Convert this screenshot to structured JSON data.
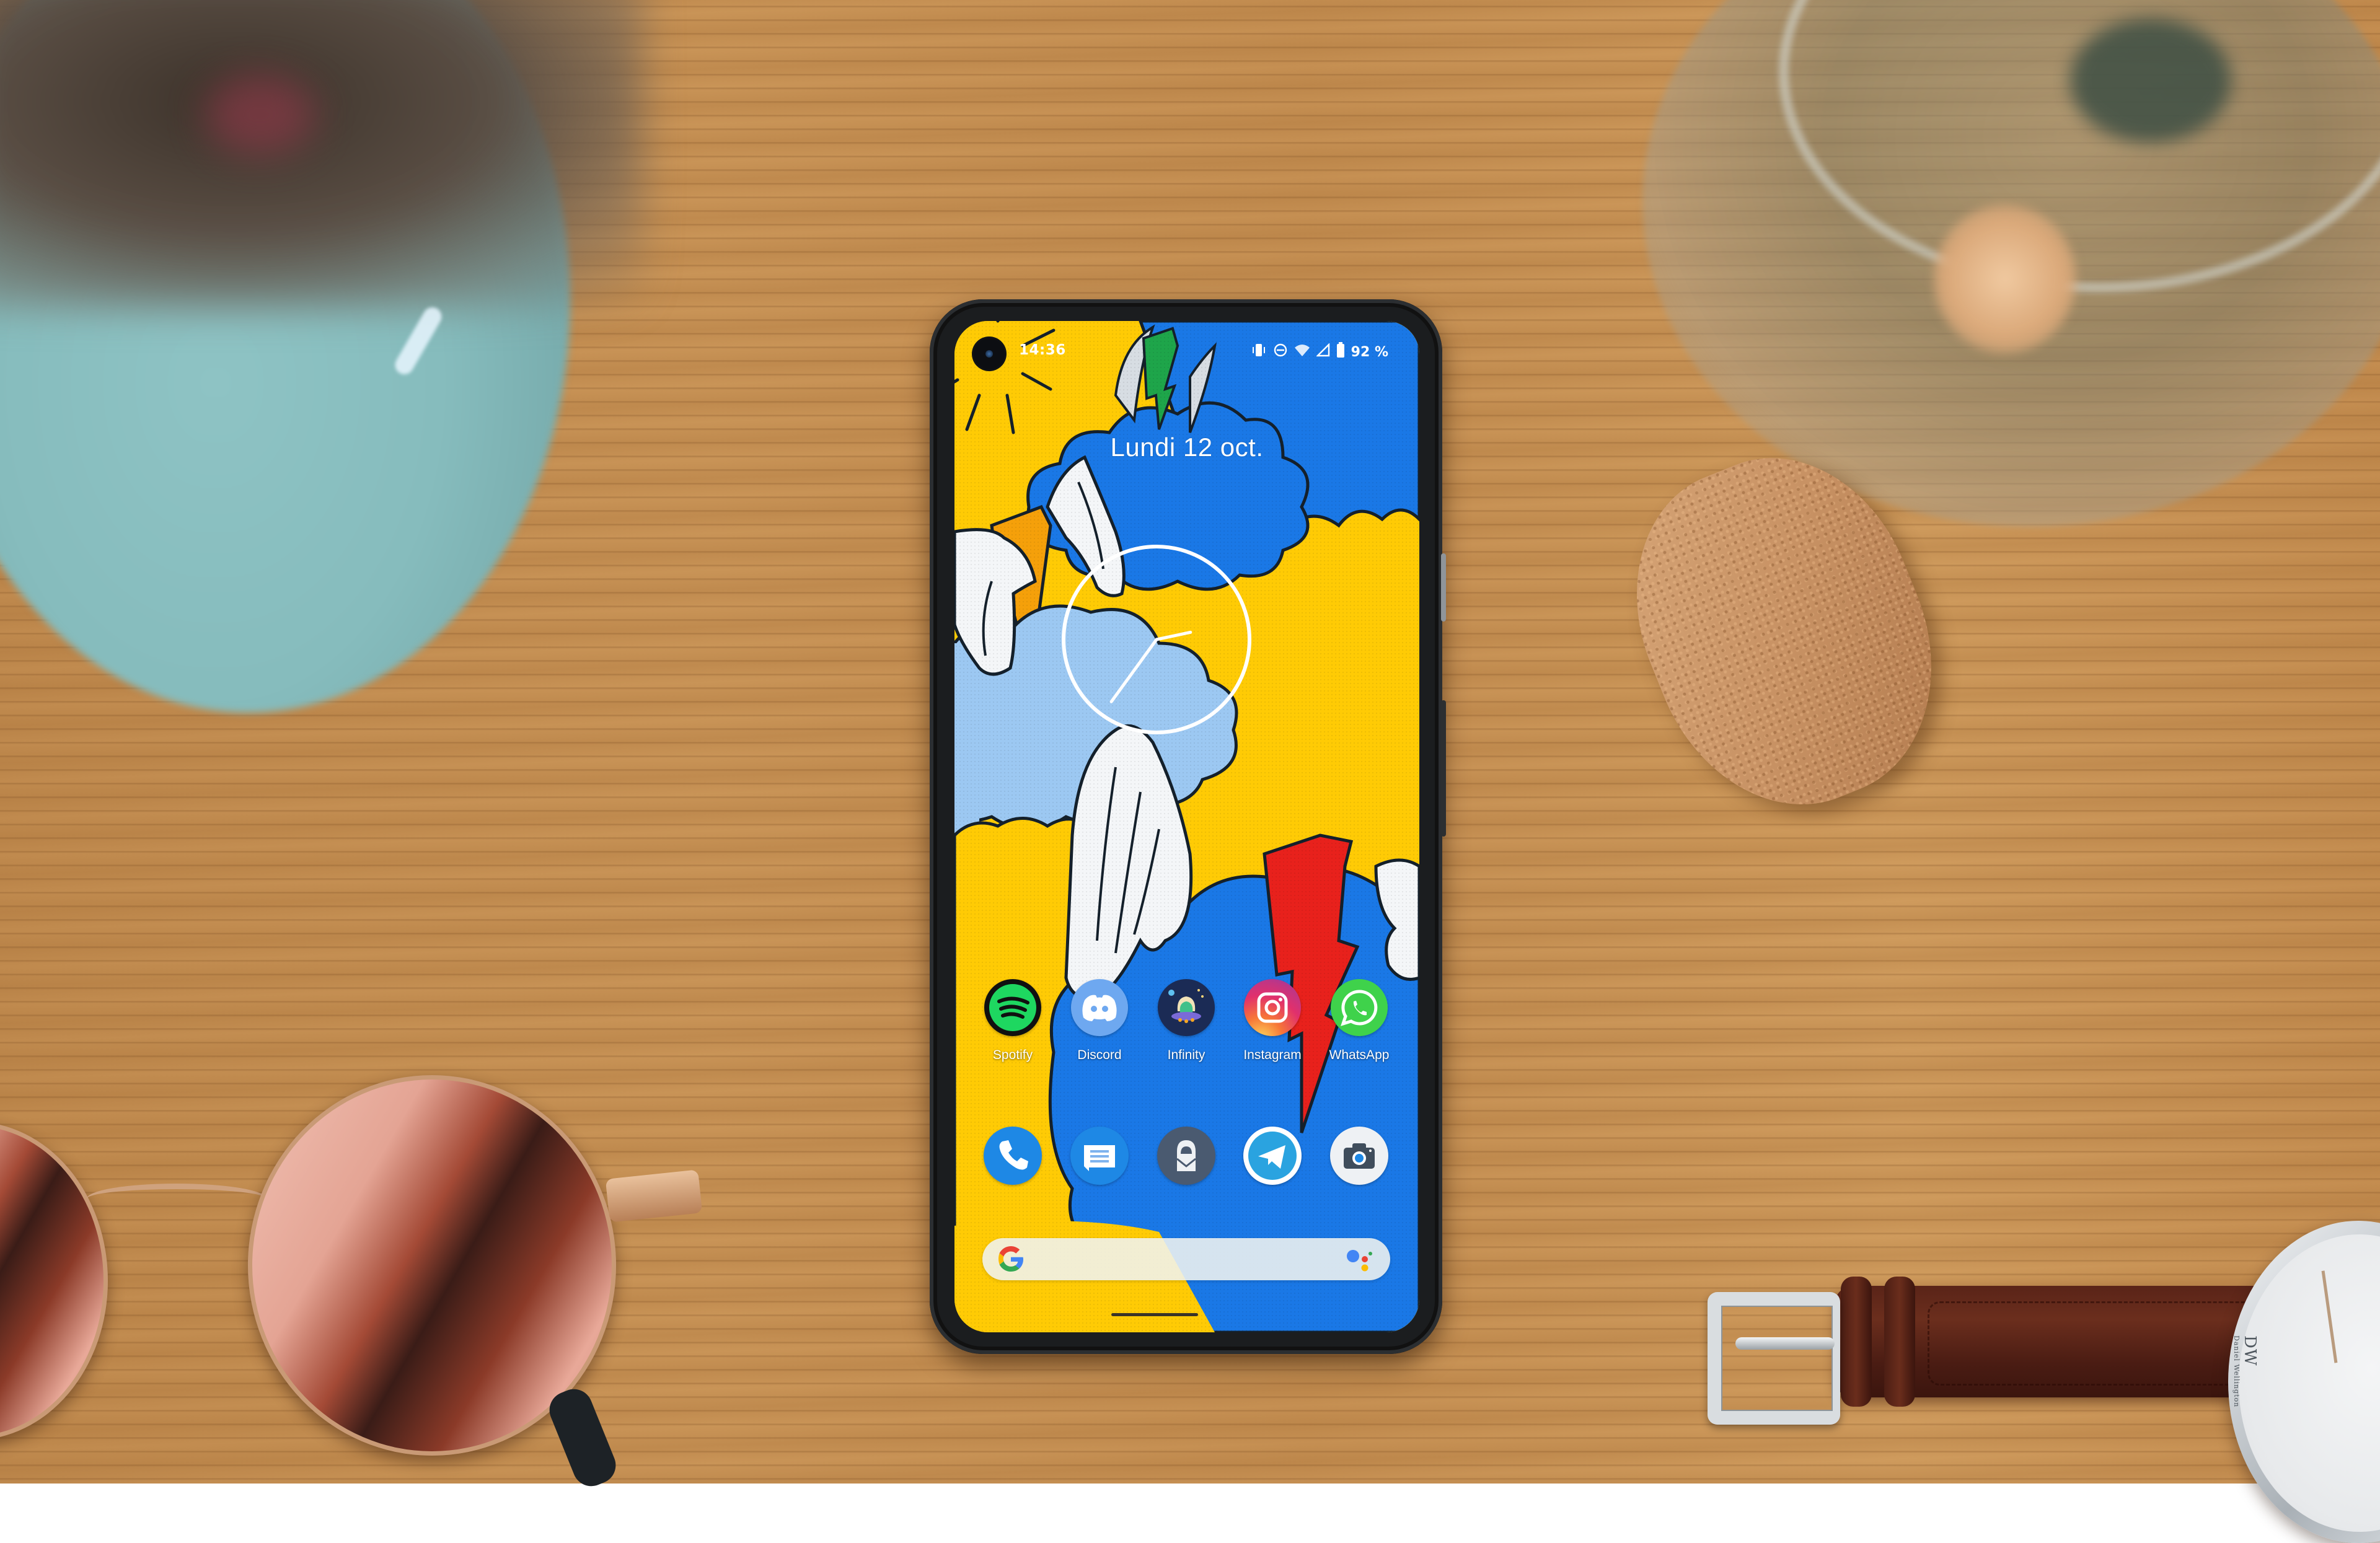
{
  "scene": {
    "description": "Smartphone lying on a wooden desk showing its Android home screen",
    "props": [
      "teal vase (blurred)",
      "glass jar with dried flowers",
      "cork stopper",
      "rose-gold round sunglasses",
      "wristwatch with brown leather strap"
    ],
    "watch_brand_logo": "DW",
    "watch_brand_name": "Daniel Wellington"
  },
  "statusbar": {
    "time": "14:36",
    "icons": [
      "vibrate-icon",
      "data-saver-icon",
      "wifi-icon",
      "cell-signal-icon",
      "battery-icon"
    ],
    "battery_percent_label": "92 %",
    "battery_level": 0.92
  },
  "home": {
    "date": "Lundi 12 oct.",
    "clock_widget": {
      "hour": 14,
      "minute": 36
    },
    "apps": [
      {
        "label": "Spotify",
        "icon": "spotify-icon",
        "color": "#1ed760"
      },
      {
        "label": "Discord",
        "icon": "discord-icon",
        "color": "#6ea8f0"
      },
      {
        "label": "Infinity",
        "icon": "infinity-icon",
        "color": "#1b2b55"
      },
      {
        "label": "Instagram",
        "icon": "instagram-icon",
        "color": "#e1306c"
      },
      {
        "label": "WhatsApp",
        "icon": "whatsapp-icon",
        "color": "#3fd24b"
      }
    ],
    "dock": [
      {
        "name": "Phone",
        "icon": "phone-icon",
        "color": "#1e88e5"
      },
      {
        "name": "Messages",
        "icon": "messages-icon",
        "color": "#1e88e5"
      },
      {
        "name": "ProtonMail",
        "icon": "protonmail-icon",
        "color": "#4a5a70"
      },
      {
        "name": "Telegram",
        "icon": "telegram-icon",
        "color": "#2aa3e0"
      },
      {
        "name": "Camera",
        "icon": "camera-icon",
        "color": "#eef1f4"
      }
    ],
    "search": {
      "logo": "google-g-icon",
      "assistant": "google-assistant-icon",
      "placeholder": ""
    }
  },
  "wallpaper": {
    "palette": {
      "yellow": "#ffcb05",
      "blue": "#1a78e6",
      "light_blue": "#9cc8f2",
      "white": "#f4f6f8",
      "orange": "#f5a00a",
      "red": "#e8211c",
      "green": "#1ea54a",
      "outline": "#14202b"
    }
  }
}
